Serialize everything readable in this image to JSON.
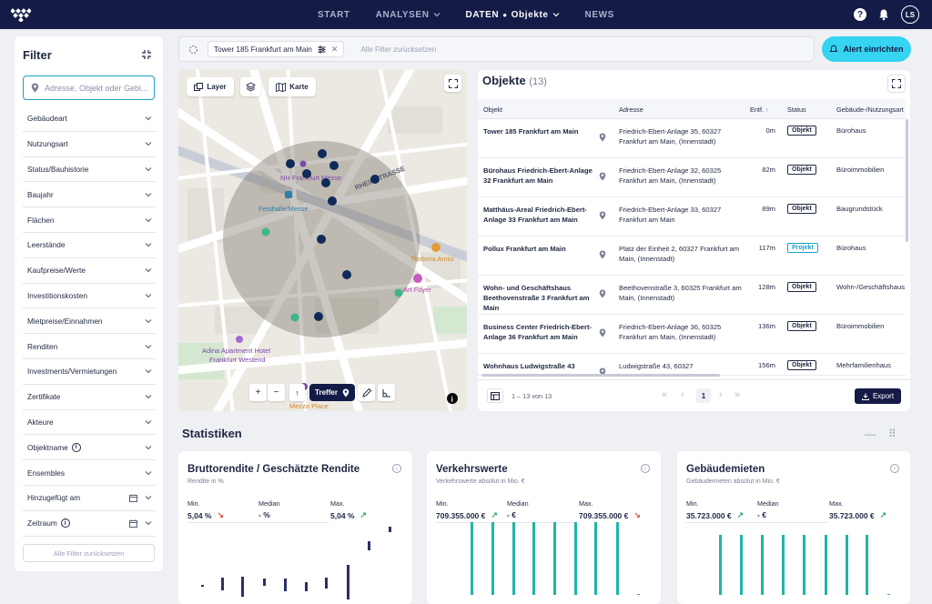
{
  "nav": {
    "items": [
      {
        "label": "START",
        "has_chevron": false
      },
      {
        "label": "ANALYSEN",
        "has_chevron": true
      },
      {
        "label": "DATEN",
        "sub": "Objekte",
        "has_chevron": true,
        "active": true
      },
      {
        "label": "NEWS",
        "has_chevron": false
      }
    ],
    "help": "?",
    "avatar": "LS"
  },
  "filter": {
    "title": "Filter",
    "search_placeholder": "Adresse, Objekt oder Gebi...",
    "items": [
      {
        "label": "Gebäudeart"
      },
      {
        "label": "Nutzungsart"
      },
      {
        "label": "Status/Bauhistorie"
      },
      {
        "label": "Baujahr"
      },
      {
        "label": "Flächen"
      },
      {
        "label": "Leerstände"
      },
      {
        "label": "Kaufpreise/Werte"
      },
      {
        "label": "Investitionskosten"
      },
      {
        "label": "Mietpreise/Einnahmen"
      },
      {
        "label": "Renditen"
      },
      {
        "label": "Investments/Vermietungen"
      },
      {
        "label": "Zertifikate"
      },
      {
        "label": "Akteure"
      },
      {
        "label": "Objektname",
        "info": true
      },
      {
        "label": "Ensembles"
      },
      {
        "label": "Hinzugefügt am",
        "calendar": true
      },
      {
        "label": "Zeitraum",
        "info": true,
        "calendar": true
      }
    ],
    "reset_label": "Alle Filter zurücksetzen"
  },
  "topbar": {
    "chip_label": "Tower 185 Frankfurt am Main",
    "reset_label": "Alle Filter zurücksetzen",
    "alert_label": "Alert einrichten"
  },
  "map": {
    "layer_label": "Layer",
    "map_label": "Karte",
    "treffer_label": "Treffer",
    "labels": {
      "street": "RHEINSTRASSE",
      "hotel1": "NH Frankfurt Messe",
      "festhalle": "Festhalle/Messe",
      "trattoria": "Trattoria Amici",
      "foyer": "Art Foyer",
      "adina": "Adina Apartment Hotel Frankfurt Westend",
      "mezzo": "Mezzo Place"
    }
  },
  "objekte": {
    "title": "Objekte",
    "count": "(13)",
    "columns": [
      "Objekt",
      "Adresse",
      "Entf.",
      "Status",
      "Gebäude-/Nutzungsart"
    ],
    "rows": [
      {
        "name": "Tower 185 Frankfurt am Main",
        "address": "Friedrich-Ebert-Anlage 35, 60327 Frankfurt am Main, (Innenstadt)",
        "dist": "0m",
        "status": "Objekt",
        "type": "Bürohaus"
      },
      {
        "name": "Bürohaus Friedrich-Ebert-Anlage 32 Frankfurt am Main",
        "address": "Friedrich-Ebert-Anlage 32, 60325 Frankfurt am Main, (Innenstadt)",
        "dist": "82m",
        "status": "Objekt",
        "type": "Büroimmobilien"
      },
      {
        "name": "Matthäus-Areal Friedrich-Ebert-Anlage 33 Frankfurt am Main",
        "address": "Friedrich-Ebert-Anlage 33, 60327 Frankfurt am Main",
        "dist": "89m",
        "status": "Objekt",
        "type": "Baugrundstück"
      },
      {
        "name": "Pollux Frankfurt am Main",
        "address": "Platz der Einheit 2, 60327 Frankfurt am Main, (Innenstadt)",
        "dist": "117m",
        "status": "Projekt",
        "type": "Bürohaus"
      },
      {
        "name": "Wohn- und Geschäftshaus Beethovenstraße 3 Frankfurt am Main",
        "address": "Beethovenstraße 3, 60325 Frankfurt am Main, (Innenstadt)",
        "dist": "128m",
        "status": "Objekt",
        "type": "Wohn-/Geschäftshaus"
      },
      {
        "name": "Business Center Friedrich-Ebert-Anlage 36 Frankfurt am Main",
        "address": "Friedrich-Ebert-Anlage 36, 60325 Frankfurt am Main, (Innenstadt)",
        "dist": "136m",
        "status": "Objekt",
        "type": "Büroimmobilien"
      },
      {
        "name": "Wohnhaus Ludwigstraße 43",
        "address": "Ludwigstraße 43, 60327",
        "dist": "156m",
        "status": "Objekt",
        "type": "Mehrfamilienhaus"
      }
    ],
    "pagination": "1 – 13 von 13",
    "page": "1",
    "export_label": "Export"
  },
  "stats": {
    "title": "Statistiken",
    "min_label": "Min.",
    "median_label": "Median",
    "max_label": "Max.",
    "cards": [
      {
        "title": "Bruttorendite / Geschätzte Rendite",
        "subtitle": "Rendite in %",
        "min": "5,04 %",
        "min_dir": "down",
        "median": "- %",
        "max": "5,04 %",
        "max_dir": "up"
      },
      {
        "title": "Verkehrswerte",
        "subtitle": "Verkehrswerte absolut in Mio. €",
        "min": "709.355.000 €",
        "min_dir": "up",
        "median": "- €",
        "max": "709.355.000 €",
        "max_dir": "down"
      },
      {
        "title": "Gebäudemieten",
        "subtitle": "Gebäudemieten absolut in Mio. €",
        "min": "35.723.000 €",
        "min_dir": "up",
        "median": "- €",
        "max": "35.723.000 €",
        "max_dir": "up"
      }
    ]
  },
  "colors": {
    "navy": "#141b47",
    "accent": "#35d4f0",
    "teal": "#1fb5a8",
    "bar_navy": "#2b2f6b"
  }
}
